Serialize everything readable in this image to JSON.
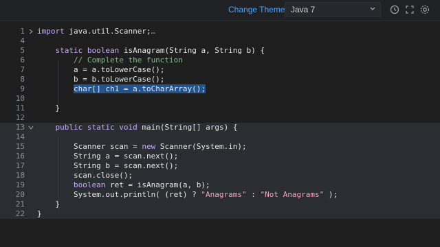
{
  "toolbar": {
    "change_theme": "Change Theme",
    "language": "Java 7",
    "icons": [
      "history-icon",
      "fullscreen-icon",
      "settings-icon"
    ]
  },
  "editor": {
    "lines": [
      {
        "n": "1",
        "tokens": [
          [
            "kw",
            "import"
          ],
          [
            "ty",
            " java.util.Scanner;"
          ],
          [
            "faded",
            "…"
          ]
        ]
      },
      {
        "n": "4",
        "tokens": []
      },
      {
        "n": "5",
        "tokens": [
          [
            "ty",
            "    "
          ],
          [
            "kw",
            "static"
          ],
          [
            "ty",
            " "
          ],
          [
            "kw",
            "boolean"
          ],
          [
            "ty",
            " isAnagram(String a, String b) {"
          ]
        ]
      },
      {
        "n": "6",
        "tokens": [
          [
            "cm",
            "        // Complete the function"
          ]
        ]
      },
      {
        "n": "7",
        "tokens": [
          [
            "ty",
            "        a = a.toLowerCase();"
          ]
        ]
      },
      {
        "n": "8",
        "tokens": [
          [
            "ty",
            "        b = b.toLowerCase();"
          ]
        ]
      },
      {
        "n": "9",
        "tokens": [
          [
            "ty",
            "        "
          ],
          [
            "sel",
            "char[] ch1 = a.toCharArray();"
          ]
        ]
      },
      {
        "n": "10",
        "tokens": []
      },
      {
        "n": "11",
        "tokens": [
          [
            "ty",
            "    }"
          ]
        ]
      },
      {
        "n": "12",
        "tokens": []
      },
      {
        "n": "13",
        "tokens": [
          [
            "ty",
            "    "
          ],
          [
            "kw",
            "public"
          ],
          [
            "ty",
            " "
          ],
          [
            "kw",
            "static"
          ],
          [
            "ty",
            " "
          ],
          [
            "kw",
            "void"
          ],
          [
            "ty",
            " main(String[] args) {"
          ]
        ]
      },
      {
        "n": "14",
        "tokens": []
      },
      {
        "n": "15",
        "tokens": [
          [
            "ty",
            "        Scanner scan = "
          ],
          [
            "kw",
            "new"
          ],
          [
            "ty",
            " Scanner(System.in);"
          ]
        ]
      },
      {
        "n": "16",
        "tokens": [
          [
            "ty",
            "        String a = scan.next();"
          ]
        ]
      },
      {
        "n": "17",
        "tokens": [
          [
            "ty",
            "        String b = scan.next();"
          ]
        ]
      },
      {
        "n": "18",
        "tokens": [
          [
            "ty",
            "        scan.close();"
          ]
        ]
      },
      {
        "n": "19",
        "tokens": [
          [
            "ty",
            "        "
          ],
          [
            "kw",
            "boolean"
          ],
          [
            "ty",
            " ret = isAnagram(a, b);"
          ]
        ]
      },
      {
        "n": "20",
        "tokens": [
          [
            "ty",
            "        System.out.println( (ret) ? "
          ],
          [
            "str",
            "\"Anagrams\""
          ],
          [
            "ty",
            " : "
          ],
          [
            "str",
            "\"Not Anagrams\""
          ],
          [
            "ty",
            " );"
          ]
        ]
      },
      {
        "n": "21",
        "tokens": [
          [
            "ty",
            "    }"
          ]
        ]
      },
      {
        "n": "22",
        "tokens": [
          [
            "ty",
            "}"
          ]
        ]
      }
    ]
  }
}
